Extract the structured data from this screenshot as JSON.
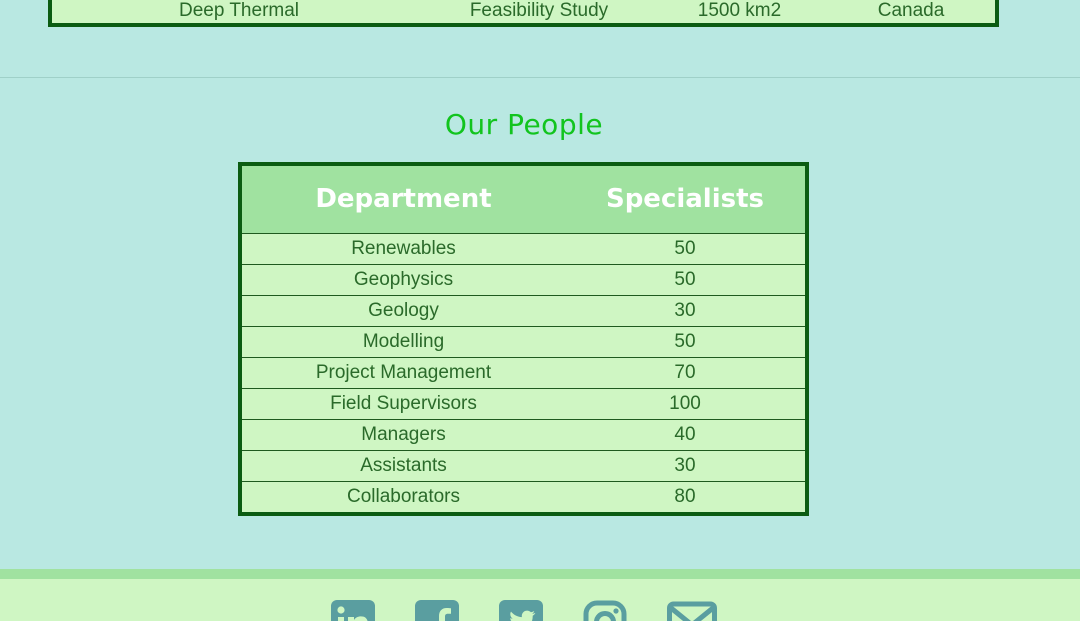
{
  "projects": {
    "last_row": [
      "Deep Thermal",
      "Feasibility Study",
      "1500 km2",
      "Canada"
    ]
  },
  "people": {
    "title": "Our People",
    "headers": [
      "Department",
      "Specialists"
    ],
    "rows": [
      [
        "Renewables",
        "50"
      ],
      [
        "Geophysics",
        "50"
      ],
      [
        "Geology",
        "30"
      ],
      [
        "Modelling",
        "50"
      ],
      [
        "Project Management",
        "70"
      ],
      [
        "Field Supervisors",
        "100"
      ],
      [
        "Managers",
        "40"
      ],
      [
        "Assistants",
        "30"
      ],
      [
        "Collaborators",
        "80"
      ]
    ]
  },
  "footer": {
    "icons": [
      "linkedin-icon",
      "facebook-icon",
      "twitter-icon",
      "instagram-icon",
      "email-icon"
    ],
    "icon_color": "#5a9ea0"
  },
  "colors": {
    "background": "#b9e8e2",
    "title_green": "#12c41e",
    "table_border": "#0b5c12",
    "table_header": "#a0e2a0",
    "row_bg": "#cff6c3"
  }
}
